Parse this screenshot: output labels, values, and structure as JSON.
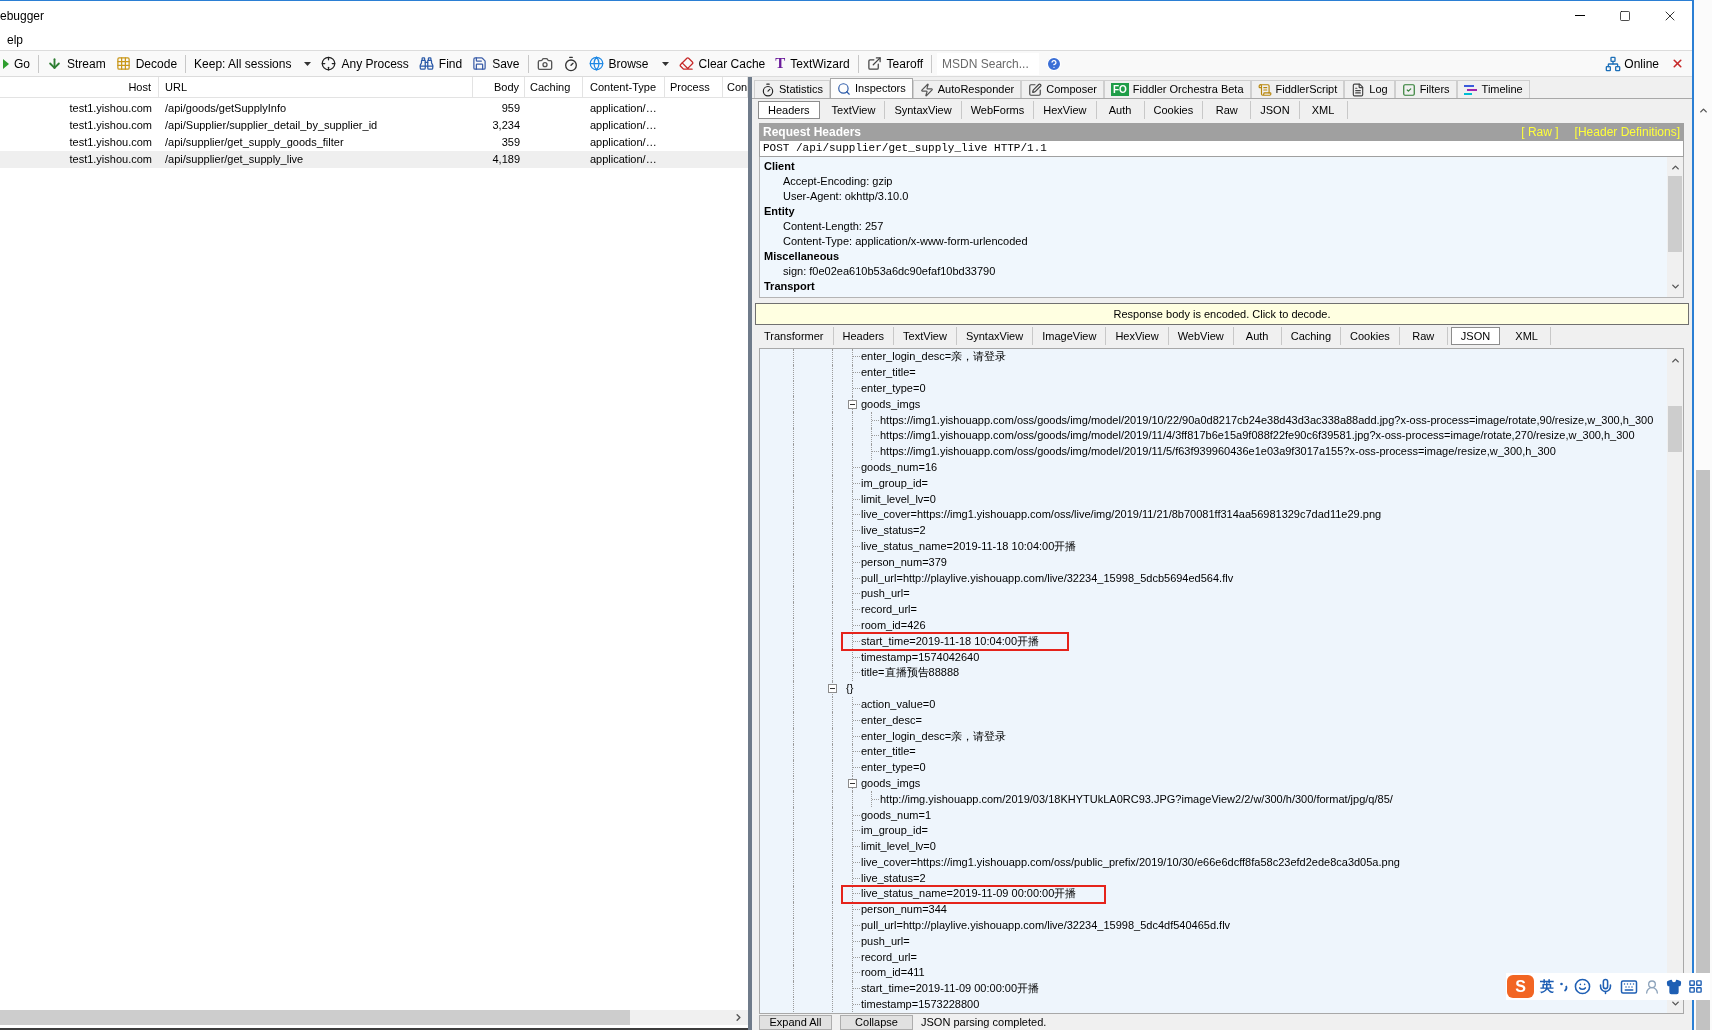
{
  "window": {
    "title": "ebugger"
  },
  "menu": [
    "elp"
  ],
  "toolbar": {
    "groups": [
      [
        {
          "kind": "button",
          "label": "Go"
        }
      ],
      [
        {
          "kind": "button",
          "label": "Stream"
        },
        {
          "kind": "button",
          "label": "Decode"
        }
      ],
      [
        {
          "kind": "dropdown",
          "label": "Keep: All sessions"
        },
        {
          "kind": "button",
          "label": "Any Process"
        },
        {
          "kind": "button",
          "label": "Find"
        },
        {
          "kind": "button",
          "label": "Save"
        }
      ],
      [
        {
          "kind": "icon"
        },
        {
          "kind": "icon"
        },
        {
          "kind": "dropdown",
          "label": "Browse"
        },
        {
          "kind": "button",
          "label": "Clear Cache"
        },
        {
          "kind": "button",
          "label": "TextWizard",
          "glyph": "T"
        }
      ],
      [
        {
          "kind": "button",
          "label": "Tearoff"
        }
      ],
      [
        {
          "kind": "search",
          "placeholder": "MSDN Search..."
        },
        {
          "kind": "icon"
        }
      ]
    ],
    "online": "Online"
  },
  "sessions": {
    "columns": [
      "Host",
      "URL",
      "Body",
      "Caching",
      "Content-Type",
      "Process",
      "Con"
    ],
    "rows": [
      {
        "host": "test1.yishou.com",
        "url": "/api/goods/getSupplyInfo",
        "body": "959",
        "content_type": "application/…",
        "selected": false
      },
      {
        "host": "test1.yishou.com",
        "url": "/api/Supplier/supplier_detail_by_supplier_id",
        "body": "3,234",
        "content_type": "application/…",
        "selected": false
      },
      {
        "host": "test1.yishou.com",
        "url": "/api/supplier/get_supply_goods_filter",
        "body": "359",
        "content_type": "application/…",
        "selected": false
      },
      {
        "host": "test1.yishou.com",
        "url": "/api/supplier/get_supply_live",
        "body": "4,189",
        "content_type": "application/…",
        "selected": true
      }
    ]
  },
  "inspector_tabs": [
    {
      "label": "Statistics",
      "selected": false
    },
    {
      "label": "Inspectors",
      "selected": true
    },
    {
      "label": "AutoResponder",
      "selected": false
    },
    {
      "label": "Composer",
      "selected": false
    },
    {
      "label": "Fiddler Orchestra Beta",
      "logo": "FO",
      "selected": false
    },
    {
      "label": "FiddlerScript",
      "selected": false
    },
    {
      "label": "Log",
      "selected": false
    },
    {
      "label": "Filters",
      "selected": false
    },
    {
      "label": "Timeline",
      "selected": false
    }
  ],
  "request_tabs": [
    {
      "label": "Headers",
      "selected": true
    },
    {
      "label": "TextView",
      "selected": false
    },
    {
      "label": "SyntaxView",
      "selected": false
    },
    {
      "label": "WebForms",
      "selected": false
    },
    {
      "label": "HexView",
      "selected": false
    },
    {
      "label": "Auth",
      "selected": false
    },
    {
      "label": "Cookies",
      "selected": false
    },
    {
      "label": "Raw",
      "selected": false
    },
    {
      "label": "JSON",
      "selected": false
    },
    {
      "label": "XML",
      "selected": false
    }
  ],
  "request_headers": {
    "title": "Request Headers",
    "links": [
      "[ Raw ]",
      "[Header Definitions]"
    ],
    "request_line": "POST /api/supplier/get_supply_live HTTP/1.1",
    "groups": [
      {
        "name": "Client",
        "headers": [
          "Accept-Encoding: gzip",
          "User-Agent: okhttp/3.10.0"
        ]
      },
      {
        "name": "Entity",
        "headers": [
          "Content-Length: 257",
          "Content-Type: application/x-www-form-urlencoded"
        ]
      },
      {
        "name": "Miscellaneous",
        "headers": [
          "sign: f0e02ea610b53a6dc90efaf10bd33790"
        ]
      },
      {
        "name": "Transport"
      }
    ]
  },
  "notice": "Response body is encoded. Click to decode.",
  "response_tabs": [
    {
      "label": "Transformer",
      "selected": false
    },
    {
      "label": "Headers",
      "selected": false
    },
    {
      "label": "TextView",
      "selected": false
    },
    {
      "label": "SyntaxView",
      "selected": false
    },
    {
      "label": "ImageView",
      "selected": false
    },
    {
      "label": "HexView",
      "selected": false
    },
    {
      "label": "WebView",
      "selected": false
    },
    {
      "label": "Auth",
      "selected": false
    },
    {
      "label": "Caching",
      "selected": false
    },
    {
      "label": "Cookies",
      "selected": false
    },
    {
      "label": "Raw",
      "selected": false
    },
    {
      "label": "JSON",
      "selected": true
    },
    {
      "label": "XML",
      "selected": false
    }
  ],
  "json_tree": {
    "nodes": [
      {
        "children": [
          {
            "label": "enter_login_desc=亲，请登录",
            "highlighted": false
          },
          {
            "label": "enter_title=",
            "highlighted": false
          },
          {
            "label": "enter_type=0",
            "highlighted": false
          },
          {
            "label": "goods_imgs",
            "expanded": true,
            "highlighted": false,
            "children": [
              {
                "label": "https://img1.yishouapp.com/oss/goods/img/model/2019/10/22/90a0d8217cb24e38d43d3ac338a88add.jpg?x-oss-process=image/rotate,90/resize,w_300,h_300"
              },
              {
                "label": "https://img1.yishouapp.com/oss/goods/img/model/2019/11/4/3ff817b6e15a9f088f22fe90c6f39581.jpg?x-oss-process=image/rotate,270/resize,w_300,h_300"
              },
              {
                "label": "https://img1.yishouapp.com/oss/goods/img/model/2019/11/5/f63f939960436e1e03a9f3017a155?x-oss-process=image/resize,w_300,h_300"
              }
            ]
          },
          {
            "label": "goods_num=16",
            "highlighted": false
          },
          {
            "label": "im_group_id=",
            "highlighted": false
          },
          {
            "label": "limit_level_lv=0",
            "highlighted": false
          },
          {
            "label": "live_cover=https://img1.yishouapp.com/oss/live/img/2019/11/21/8b70081ff314aa56981329c7dad11e29.png",
            "highlighted": false
          },
          {
            "label": "live_status=2",
            "highlighted": false
          },
          {
            "label": "live_status_name=2019-11-18 10:04:00开播",
            "highlighted": false
          },
          {
            "label": "person_num=379",
            "highlighted": false
          },
          {
            "label": "pull_url=http://playlive.yishouapp.com/live/32234_15998_5dcb5694ed564.flv",
            "highlighted": false
          },
          {
            "label": "push_url=",
            "highlighted": false
          },
          {
            "label": "record_url=",
            "highlighted": false
          },
          {
            "label": "room_id=426",
            "highlighted": false
          },
          {
            "label": "start_time=2019-11-18 10:04:00开播",
            "highlighted": true
          },
          {
            "label": "timestamp=1574042640",
            "highlighted": false
          },
          {
            "label": "title=直播预告88888",
            "highlighted": false
          }
        ]
      },
      {
        "label": "{}",
        "expanded": true,
        "children": [
          {
            "label": "action_value=0",
            "highlighted": false
          },
          {
            "label": "enter_desc=",
            "highlighted": false
          },
          {
            "label": "enter_login_desc=亲，请登录",
            "highlighted": false
          },
          {
            "label": "enter_title=",
            "highlighted": false
          },
          {
            "label": "enter_type=0",
            "highlighted": false
          },
          {
            "label": "goods_imgs",
            "expanded": true,
            "highlighted": false,
            "children": [
              {
                "label": "http://img.yishouapp.com/2019/03/18KHYTUkLA0RC93.JPG?imageView2/2/w/300/h/300/format/jpg/q/85/"
              }
            ]
          },
          {
            "label": "goods_num=1",
            "highlighted": false
          },
          {
            "label": "im_group_id=",
            "highlighted": false
          },
          {
            "label": "limit_level_lv=0",
            "highlighted": false
          },
          {
            "label": "live_cover=https://img1.yishouapp.com/oss/public_prefix/2019/10/30/e66e6dcff8fa58c23efd2ede8ca3d05a.png",
            "highlighted": false
          },
          {
            "label": "live_status=2",
            "highlighted": false
          },
          {
            "label": "live_status_name=2019-11-09 00:00:00开播",
            "highlighted": true
          },
          {
            "label": "person_num=344",
            "highlighted": false
          },
          {
            "label": "pull_url=http://playlive.yishouapp.com/live/32234_15998_5dc4df540465d.flv",
            "highlighted": false
          },
          {
            "label": "push_url=",
            "highlighted": false
          },
          {
            "label": "record_url=",
            "highlighted": false
          },
          {
            "label": "room_id=411",
            "highlighted": false
          },
          {
            "label": "start_time=2019-11-09 00:00:00开播",
            "highlighted": false
          },
          {
            "label": "timestamp=1573228800",
            "highlighted": false
          }
        ]
      }
    ]
  },
  "json_footer": {
    "buttons": [
      "Expand All",
      "Collapse"
    ],
    "status": "JSON parsing completed."
  },
  "ime_toolbar": {
    "logo": "S",
    "mode": "英"
  }
}
